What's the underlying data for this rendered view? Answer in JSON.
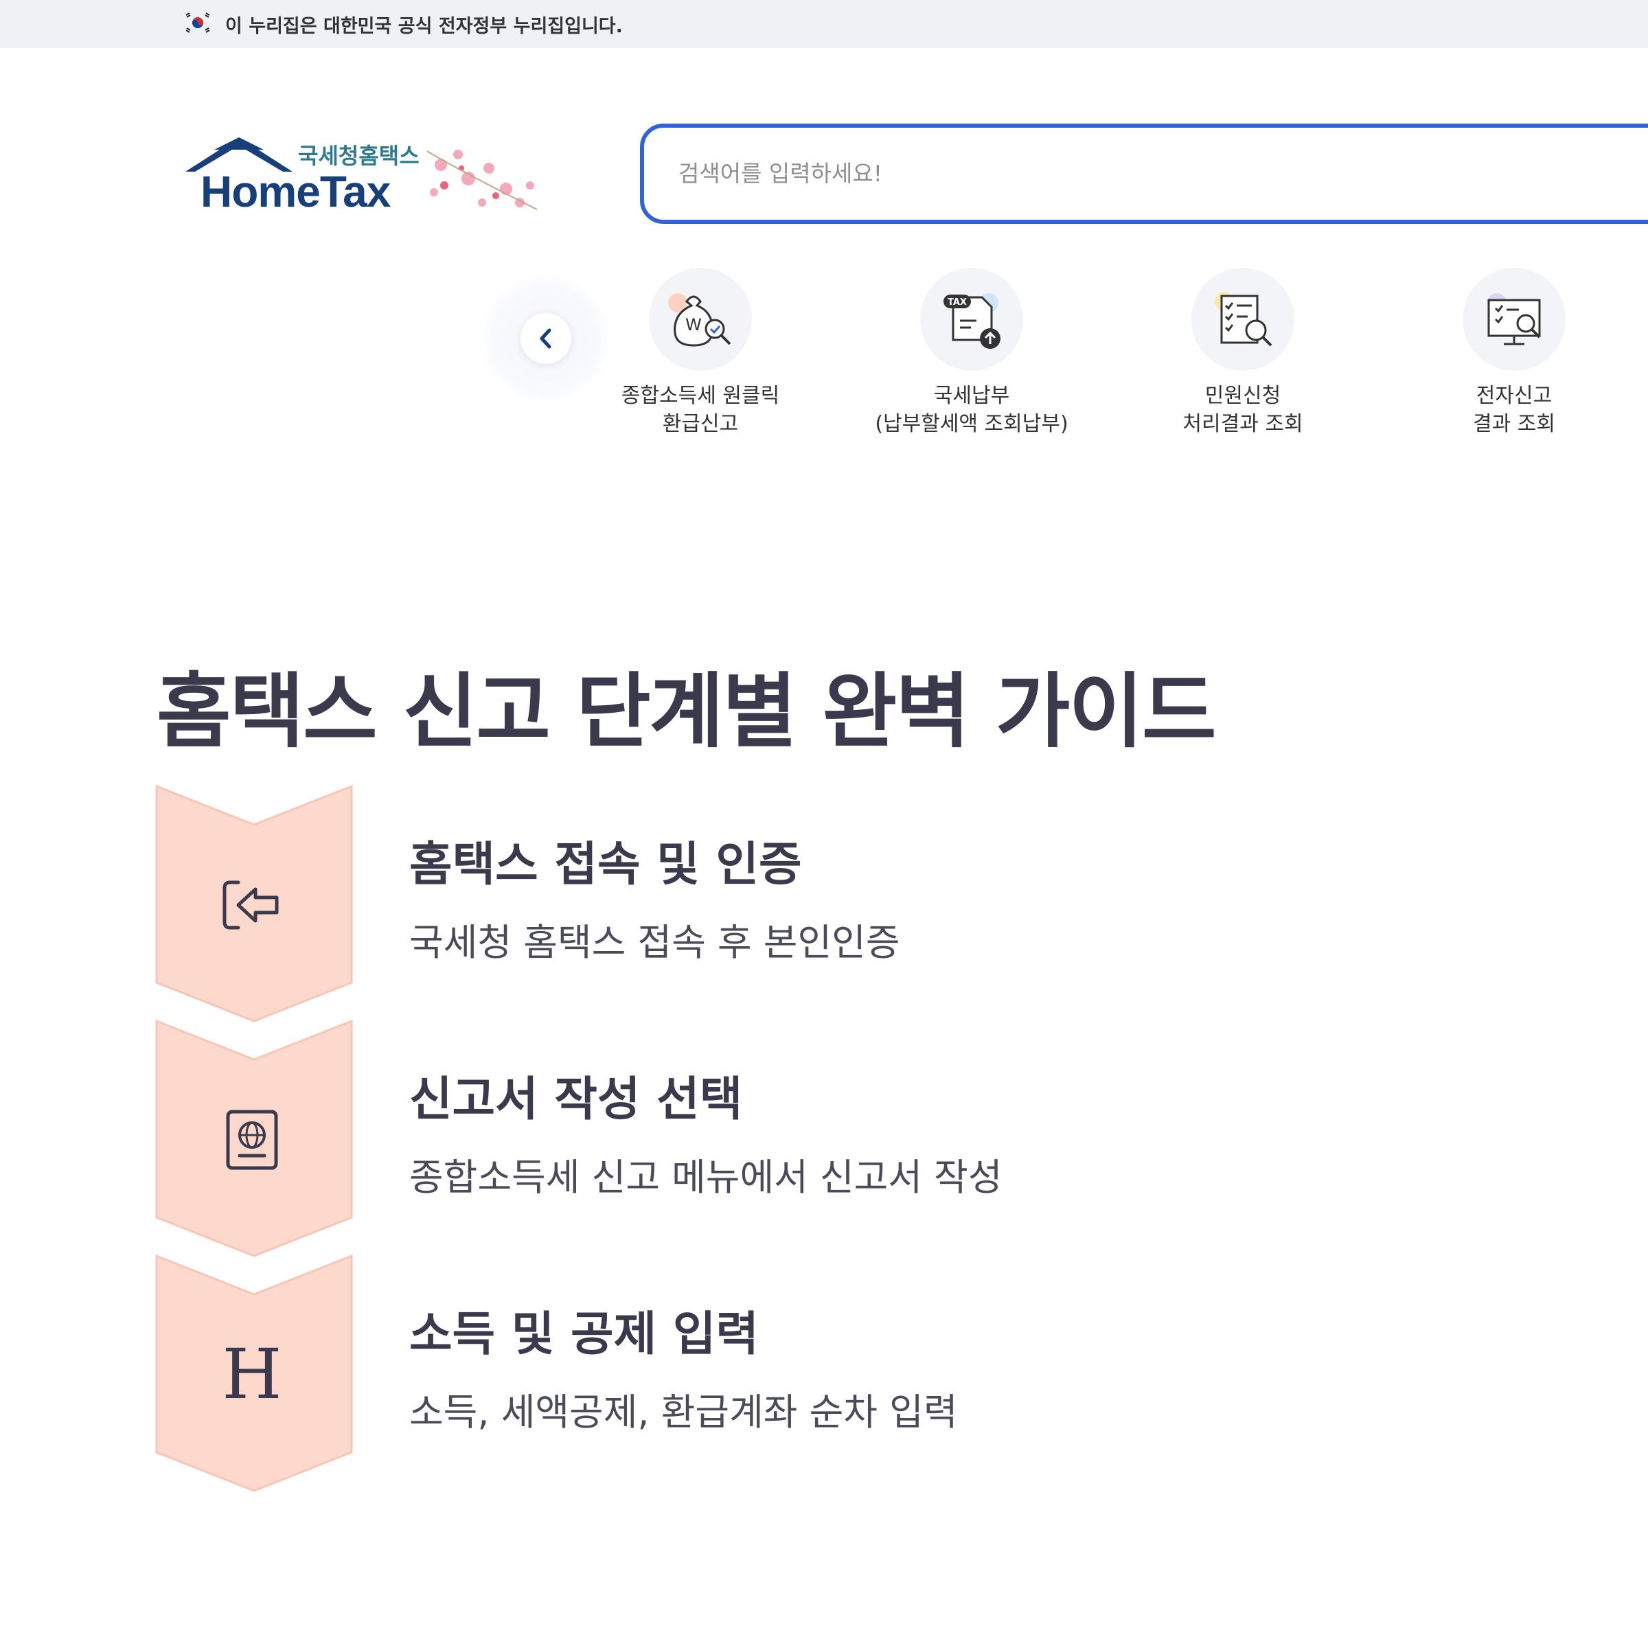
{
  "gov_banner": {
    "text": "이 누리집은 대한민국 공식 전자정부 누리집입니다."
  },
  "logo": {
    "korean": "국세청홈택스",
    "english": "HomeTax"
  },
  "search": {
    "placeholder": "검색어를 입력하세요!"
  },
  "quick_menu": {
    "prev_icon": "chevron-left-icon",
    "items": [
      {
        "line1": "종합소득세 원클릭",
        "line2": "환급신고",
        "icon": "money-bag-search-icon"
      },
      {
        "line1": "국세납부",
        "line2": "(납부할세액 조회납부)",
        "icon": "tax-upload-icon"
      },
      {
        "line1": "민원신청",
        "line2": "처리결과 조회",
        "icon": "checklist-search-icon"
      },
      {
        "line1": "전자신고",
        "line2": "결과 조회",
        "icon": "monitor-search-icon"
      }
    ]
  },
  "guide": {
    "title": "홈택스 신고 단계별 완벽 가이드",
    "accent_color": "#fdd9cd",
    "steps": [
      {
        "heading": "홈택스 접속 및 인증",
        "desc": "국세청 홈택스 접속 후 본인인증",
        "icon": "login-arrow-icon"
      },
      {
        "heading": "신고서 작성 선택",
        "desc": "종합소득세 신고 메뉴에서 신고서 작성",
        "icon": "passport-icon"
      },
      {
        "heading": "소득 및 공제 입력",
        "desc": "소득, 세액공제, 환급계좌 순차 입력",
        "icon": "letter-h-icon",
        "glyph": "H"
      }
    ]
  }
}
